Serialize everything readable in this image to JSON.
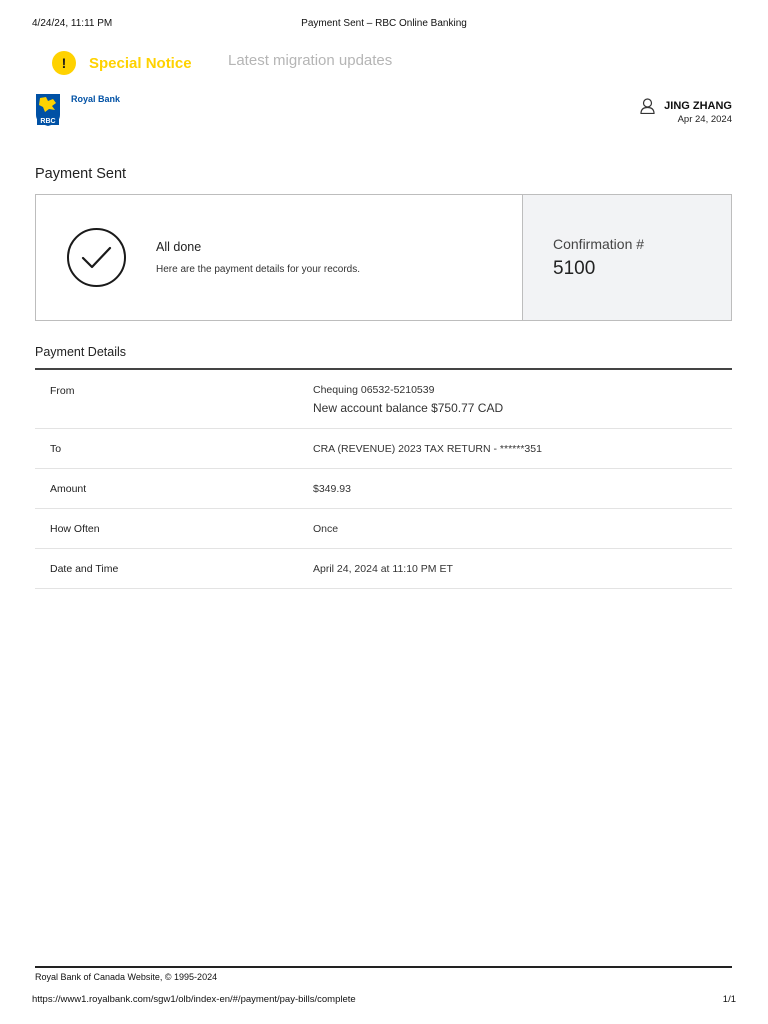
{
  "print_header": {
    "date": "4/24/24, 11:11 PM",
    "title": "Payment Sent – RBC Online Banking"
  },
  "notice": {
    "icon": "!",
    "label": "Special Notice",
    "link": "Latest migration updates",
    "color": "#ffd200"
  },
  "brand": {
    "logo_text": "Royal Bank",
    "logo_icon": "rbc-lion-shield-icon",
    "color": "#0051a5"
  },
  "user": {
    "name": "JING ZHANG",
    "date": "Apr 24, 2024",
    "icon": "user-icon"
  },
  "page_title": "Payment Sent",
  "confirmation": {
    "title": "All done",
    "subtitle": "Here are the payment details for your records.",
    "label": "Confirmation #",
    "number": "5100",
    "icon": "checkmark-circle-icon"
  },
  "details": {
    "title": "Payment Details",
    "from": {
      "label": "From",
      "account": "Chequing 06532-5210539",
      "balance": "New account balance $750.77 CAD"
    },
    "to": {
      "label": "To",
      "value": "CRA (REVENUE) 2023 TAX RETURN - ******351"
    },
    "amount": {
      "label": "Amount",
      "value": "$349.93"
    },
    "frequency": {
      "label": "How Often",
      "value": "Once"
    },
    "datetime": {
      "label": "Date and Time",
      "value": "April 24, 2024 at 11:10 PM ET"
    }
  },
  "footer": {
    "copyright": "Royal Bank of Canada Website, © 1995-2024"
  },
  "print_footer": {
    "url": "https://www1.royalbank.com/sgw1/olb/index-en/#/payment/pay-bills/complete",
    "page": "1/1"
  }
}
